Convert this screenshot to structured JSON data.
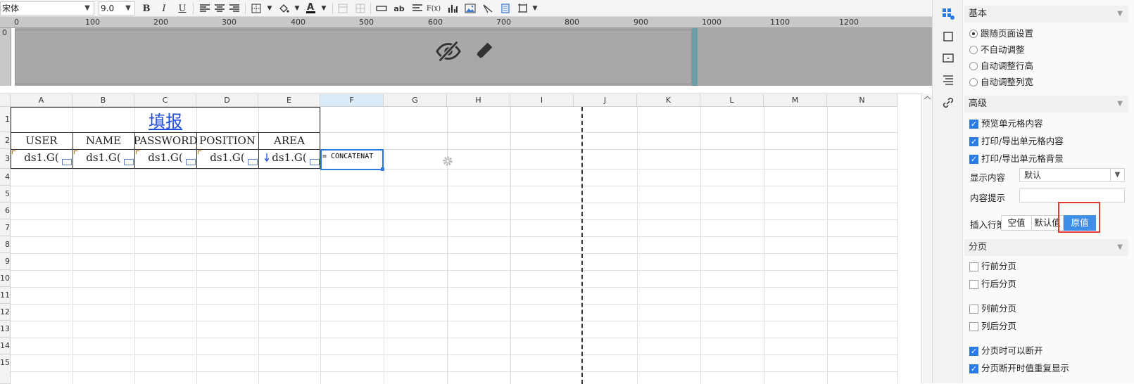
{
  "toolbar": {
    "font_family": "宋体",
    "font_size": "9.0",
    "bold": "B",
    "italic": "I",
    "underline": "U",
    "text_color_glyph": "A",
    "string_glyph": "ab",
    "formula_glyph": "F(x)",
    "accent_color": "#1f4fd6"
  },
  "ruler": {
    "top_marks": [
      "0",
      "100",
      "200",
      "300",
      "400",
      "500",
      "600",
      "700",
      "800",
      "900",
      "1000",
      "1100",
      "1200"
    ],
    "left_mark": "0"
  },
  "sheet": {
    "columns": [
      "A",
      "B",
      "C",
      "D",
      "E",
      "F",
      "G",
      "H",
      "I",
      "J",
      "K",
      "L",
      "M",
      "N"
    ],
    "active_column": "F",
    "rows": [
      "1",
      "2",
      "3",
      "4",
      "5",
      "6",
      "7",
      "8",
      "9",
      "10",
      "11",
      "12",
      "13",
      "14",
      "15"
    ],
    "title": "填报",
    "headers": [
      "USER",
      "NAME",
      "PASSWORD",
      "POSITION",
      "AREA"
    ],
    "data_cells": [
      "ds1.G(",
      "ds1.G(",
      "ds1.G(",
      "ds1.G(",
      "ds1.G("
    ],
    "formula_cell": "= CONCATENAT"
  },
  "panel": {
    "basic": {
      "title": "基本",
      "options": [
        "跟随页面设置",
        "不自动调整",
        "自动调整行高",
        "自动调整列宽"
      ],
      "selected": "跟随页面设置"
    },
    "advanced": {
      "title": "高级",
      "checks": [
        "预览单元格内容",
        "打印/导出单元格内容",
        "打印/导出单元格背景"
      ],
      "display_label": "显示内容",
      "display_value": "默认",
      "hint_label": "内容提示",
      "hint_value": "",
      "insert_label": "插入行策略",
      "insert_options": [
        "空值",
        "默认值",
        "原值"
      ],
      "insert_selected": "原值"
    },
    "paging": {
      "title": "分页",
      "checks": [
        "行前分页",
        "行后分页",
        "列前分页",
        "列后分页",
        "分页时可以断开",
        "分页断开时值重复显示"
      ],
      "checked": [
        "分页时可以断开",
        "分页断开时值重复显示"
      ]
    }
  }
}
